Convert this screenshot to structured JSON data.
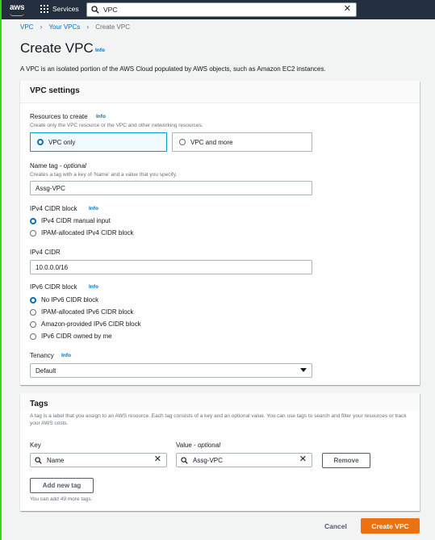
{
  "nav": {
    "logo": "aws",
    "services_label": "Services",
    "search_value": "VPC",
    "clear_glyph": "✕"
  },
  "breadcrumb": [
    "VPC",
    "Your VPCs",
    "Create VPC"
  ],
  "page": {
    "title": "Create VPC",
    "info": "Info",
    "description": "A VPC is an isolated portion of the AWS Cloud populated by AWS objects, such as Amazon EC2 instances."
  },
  "vpc_settings": {
    "heading": "VPC settings",
    "resources": {
      "label": "Resources to create",
      "info": "Info",
      "description": "Create only the VPC resource or the VPC and other networking resources.",
      "options": [
        "VPC only",
        "VPC and more"
      ],
      "selected": "VPC only"
    },
    "name_tag": {
      "label": "Name tag - ",
      "optional": "optional",
      "description": "Creates a tag with a key of 'Name' and a value that you specify.",
      "value": "Assg-VPC"
    },
    "ipv4_block": {
      "label": "IPv4 CIDR block",
      "info": "Info",
      "options": [
        "IPv4 CIDR manual input",
        "IPAM-allocated IPv4 CIDR block"
      ],
      "selected": "IPv4 CIDR manual input"
    },
    "ipv4_cidr": {
      "label": "IPv4 CIDR",
      "value": "10.0.0.0/16"
    },
    "ipv6_block": {
      "label": "IPv6 CIDR block",
      "info": "Info",
      "options": [
        "No IPv6 CIDR block",
        "IPAM-allocated IPv6 CIDR block",
        "Amazon-provided IPv6 CIDR block",
        "IPv6 CIDR owned by me"
      ],
      "selected": "No IPv6 CIDR block"
    },
    "tenancy": {
      "label": "Tenancy",
      "info": "Info",
      "value": "Default"
    }
  },
  "tags": {
    "heading": "Tags",
    "description": "A tag is a label that you assign to an AWS resource. Each tag consists of a key and an optional value. You can use tags to search and filter your resources or track your AWS costs.",
    "key_label": "Key",
    "value_label": "Value - ",
    "value_optional": "optional",
    "key_value": "Name",
    "value_value": "Assg-VPC",
    "remove_label": "Remove",
    "add_label": "Add new tag",
    "remaining": "You can add 49 more tags."
  },
  "footer": {
    "cancel_label": "Cancel",
    "create_label": "Create VPC"
  },
  "colors": {
    "nav_bg": "#232f3e",
    "link": "#0073bb",
    "primary_button": "#ec7211",
    "selected_tile_border": "#00a1c9",
    "accent_edge": "#3bd21d"
  }
}
